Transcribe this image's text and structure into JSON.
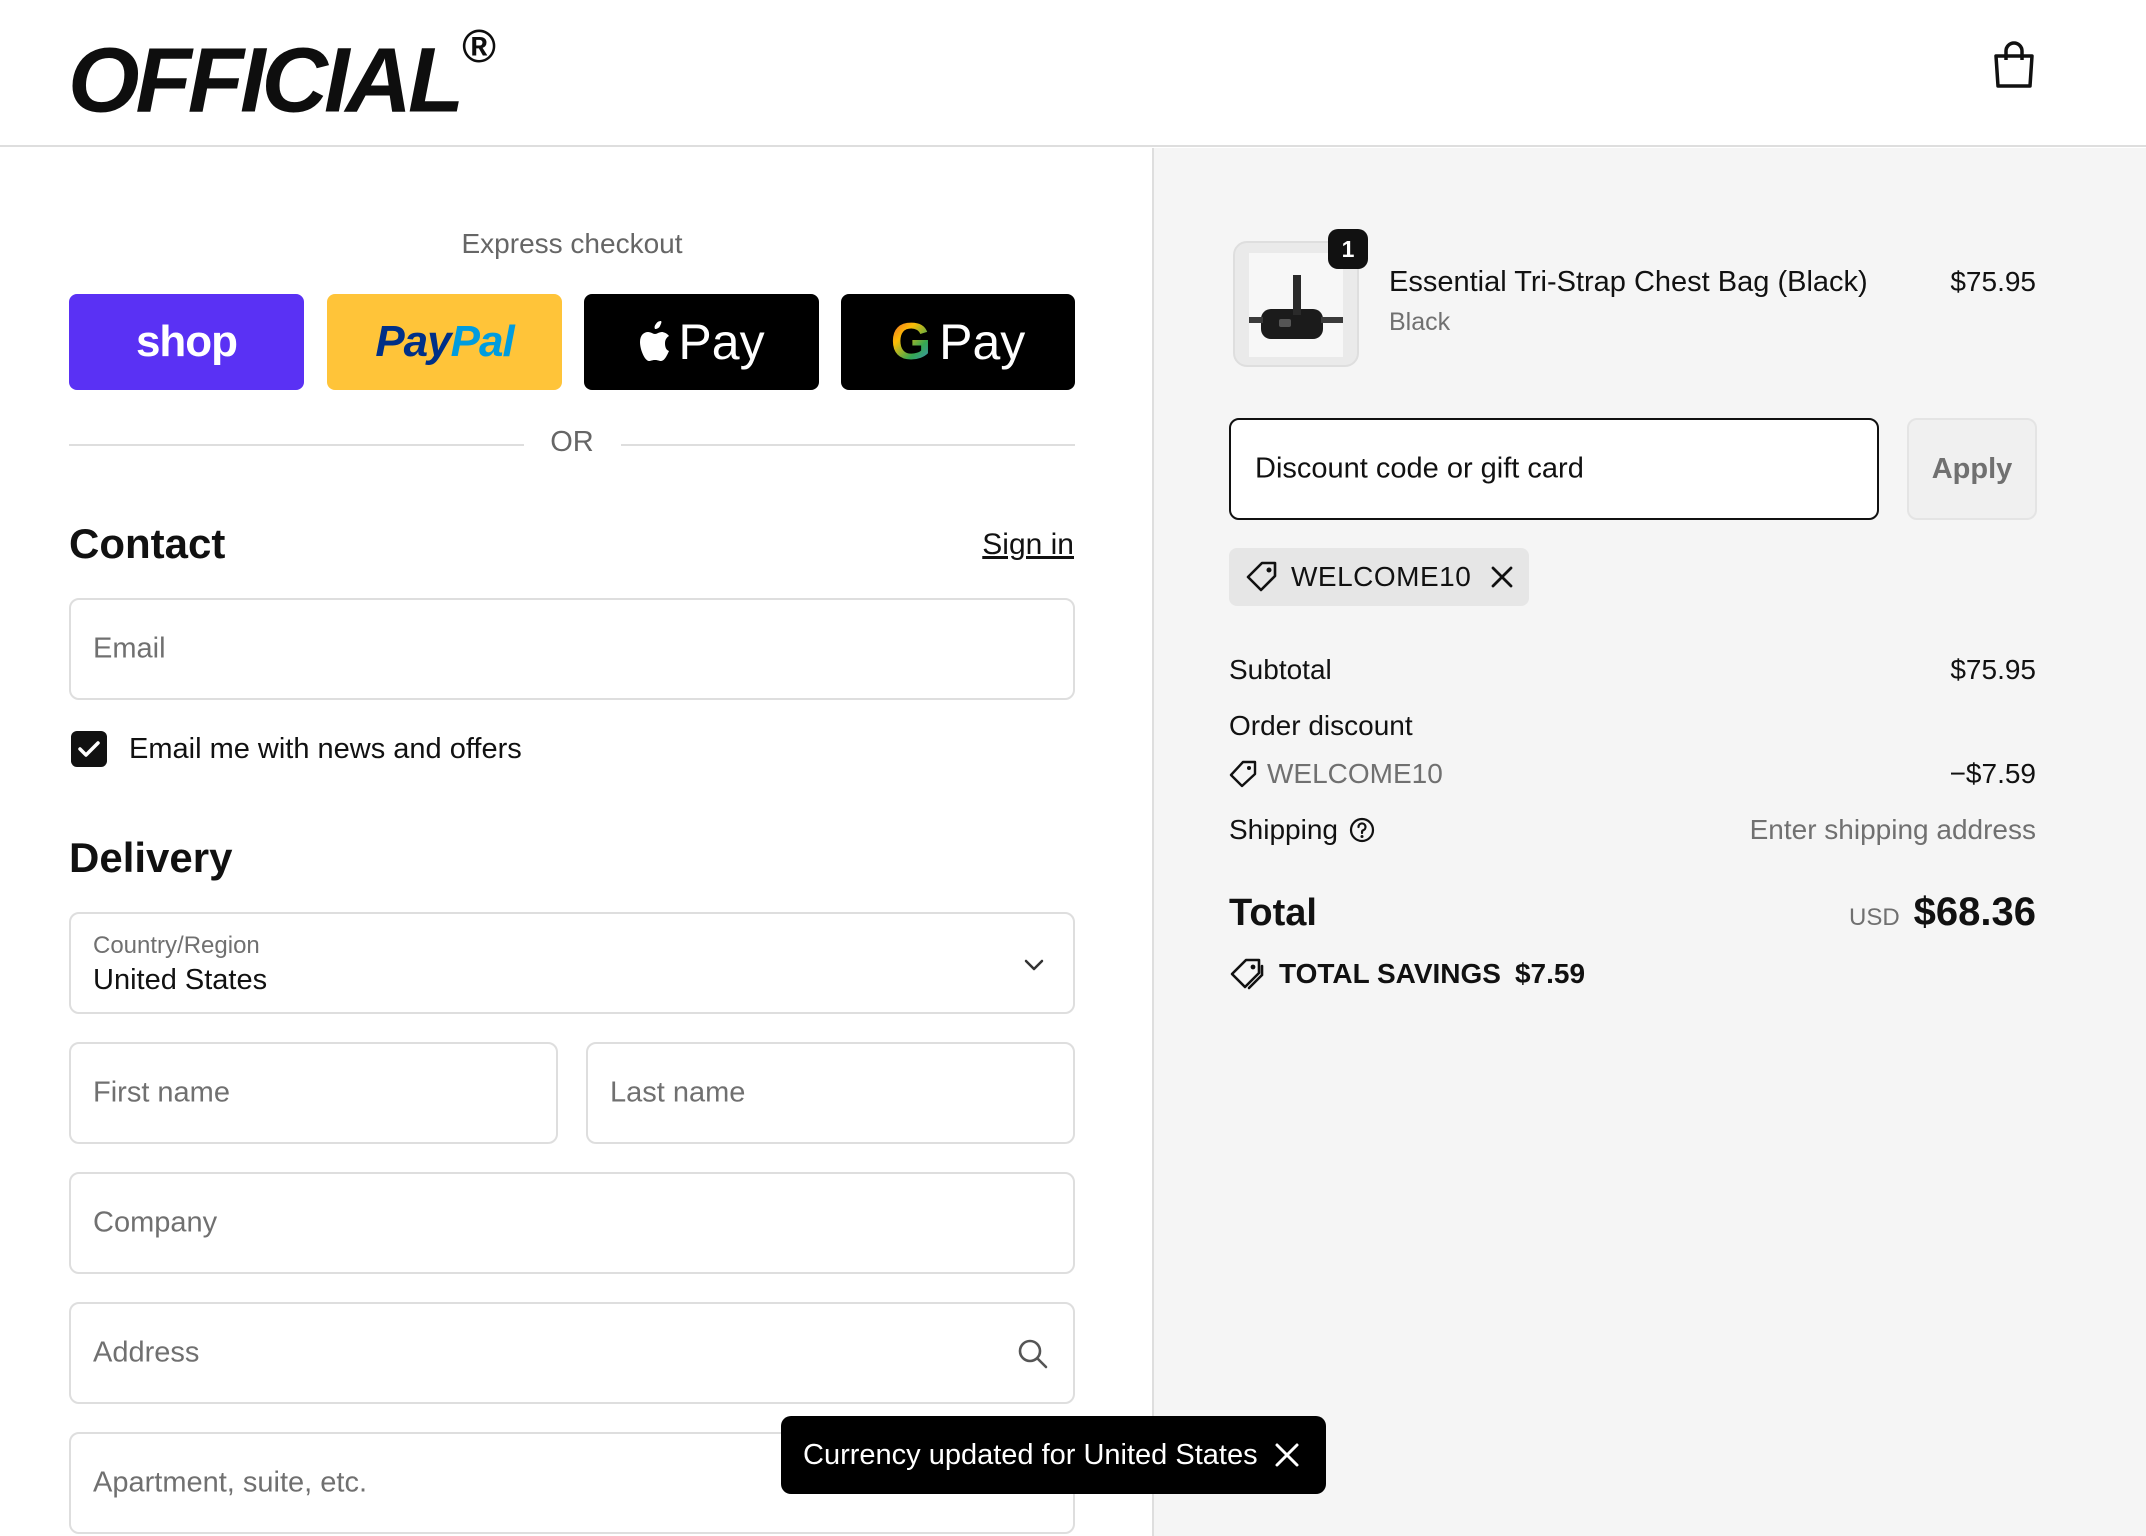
{
  "header": {
    "logo_text": "OFFICIAL",
    "logo_mark": "R",
    "cart_icon": "shopping-bag-icon"
  },
  "express": {
    "title": "Express checkout",
    "shop_label": "shop",
    "paypal_label_1": "Pay",
    "paypal_label_2": "Pal",
    "applepay_label": "Pay",
    "googlepay_g": "G",
    "googlepay_label": "Pay",
    "or_label": "OR"
  },
  "contact": {
    "title": "Contact",
    "signin_label": "Sign in",
    "email_placeholder": "Email",
    "newsletter_label": "Email me with news and offers",
    "newsletter_checked": true
  },
  "delivery": {
    "title": "Delivery",
    "country_label": "Country/Region",
    "country_value": "United States",
    "first_name_placeholder": "First name",
    "last_name_placeholder": "Last name",
    "company_placeholder": "Company",
    "address_placeholder": "Address",
    "apartment_placeholder": "Apartment, suite, etc."
  },
  "toast": {
    "message": "Currency updated for United States"
  },
  "summary": {
    "item": {
      "quantity": "1",
      "name": "Essential Tri-Strap Chest Bag (Black)",
      "variant": "Black",
      "price": "$75.95"
    },
    "discount_placeholder": "Discount code or gift card",
    "apply_label": "Apply",
    "applied_code": "WELCOME10",
    "subtotal_label": "Subtotal",
    "subtotal_value": "$75.95",
    "order_discount_label": "Order discount",
    "order_discount_code": "WELCOME10",
    "order_discount_value": "−$7.59",
    "shipping_label": "Shipping",
    "shipping_value": "Enter shipping address",
    "total_label": "Total",
    "total_currency": "USD",
    "total_value": "$68.36",
    "savings_label": "TOTAL SAVINGS",
    "savings_value": "$7.59"
  },
  "colors": {
    "shop_purple": "#5a31f4",
    "paypal_yellow": "#ffc439",
    "summary_bg": "#f5f5f5"
  }
}
